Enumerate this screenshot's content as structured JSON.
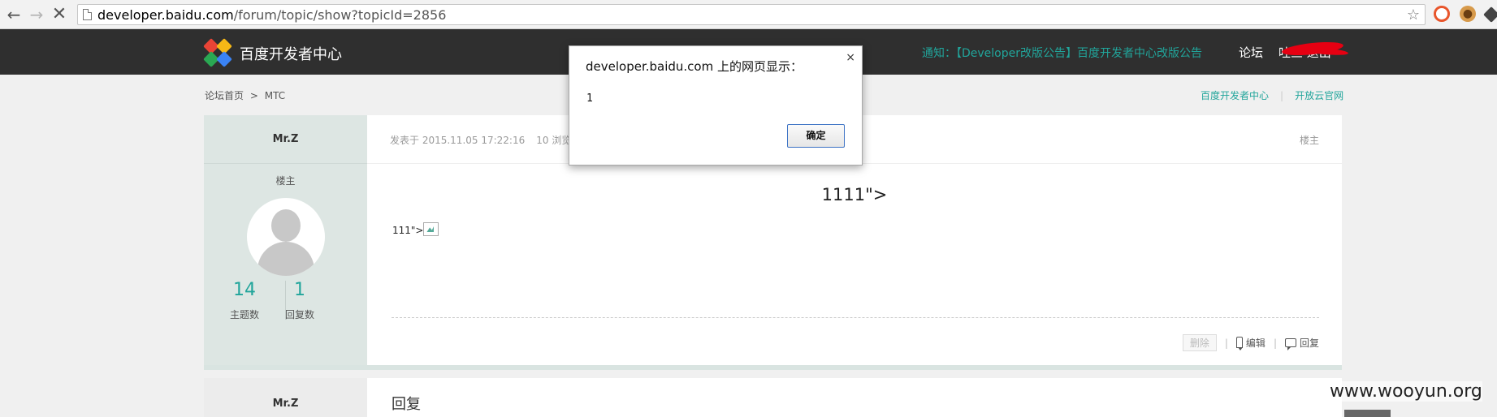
{
  "browser": {
    "url_host": "developer.baidu.com",
    "url_path": "/forum/topic/show?topicId=2856"
  },
  "header": {
    "site_name": "百度开发者中心",
    "notice": "通知：【Developer改版公告】百度开发者中心改版公告",
    "nav_forum": "论坛",
    "nav_user": "吐三 退出"
  },
  "breadcrumb": {
    "home": "论坛首页",
    "separator": ">",
    "current": "MTC"
  },
  "right_links": [
    "百度开发者中心",
    "开放云官网"
  ],
  "post": {
    "author": "Mr.Z",
    "role": "楼主",
    "topics_count": "14",
    "topics_label": "主题数",
    "replies_count": "1",
    "replies_label": "回复数",
    "posted_at": "发表于 2015.11.05 17:22:16",
    "views": "10 浏览",
    "floor": "楼主",
    "title": "1111\">",
    "body_text": "111\">",
    "actions": {
      "delete": "删除",
      "edit": "编辑",
      "reply": "回复"
    }
  },
  "reply": {
    "author": "Mr.Z",
    "title": "回复"
  },
  "dialog": {
    "title": "developer.baidu.com 上的网页显示：",
    "message": "1",
    "ok_label": "确定",
    "close": "×"
  },
  "watermark": "www.wooyun.org",
  "colors": {
    "accent": "#21a59b",
    "header_bg": "#2f2f2f",
    "sidebar_bg": "#dde6e3"
  }
}
